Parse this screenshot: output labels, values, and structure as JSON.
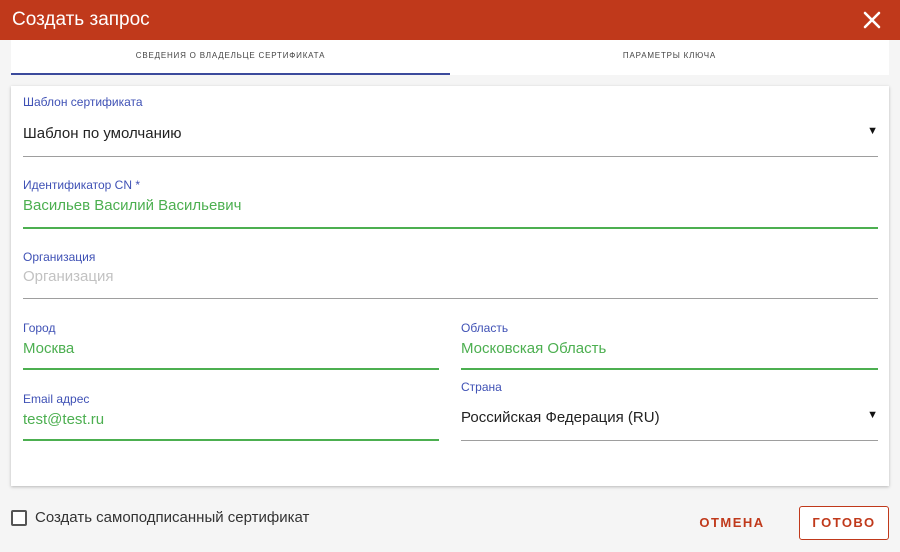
{
  "dialog": {
    "title": "Создать запрос",
    "close_icon": "close-icon"
  },
  "tabs": [
    {
      "label": "СВЕДЕНИЯ О ВЛАДЕЛЬЦЕ СЕРТИФИКАТА",
      "active": true
    },
    {
      "label": "ПАРАМЕТРЫ КЛЮЧА",
      "active": false
    }
  ],
  "form": {
    "template": {
      "label": "Шаблон сертификата",
      "value": "Шаблон по умолчанию"
    },
    "cn": {
      "label": "Идентификатор CN *",
      "value": "Васильев Василий Васильевич"
    },
    "organization": {
      "label": "Организация",
      "placeholder": "Организация",
      "value": ""
    },
    "city": {
      "label": "Город",
      "value": "Москва"
    },
    "region": {
      "label": "Область",
      "value": "Московская Область"
    },
    "email": {
      "label": "Email адрес",
      "value": "test@test.ru"
    },
    "country": {
      "label": "Страна",
      "value": "Российская Федерация (RU)"
    }
  },
  "footer": {
    "self_signed_label": "Создать самоподписанный сертификат",
    "self_signed_checked": false,
    "cancel_label": "ОТМЕНА",
    "done_label": "ГОТОВО"
  },
  "colors": {
    "accent": "#c0391b",
    "tab_indicator": "#3b4a9c",
    "label": "#3f51b5",
    "valid": "#4caf50"
  }
}
